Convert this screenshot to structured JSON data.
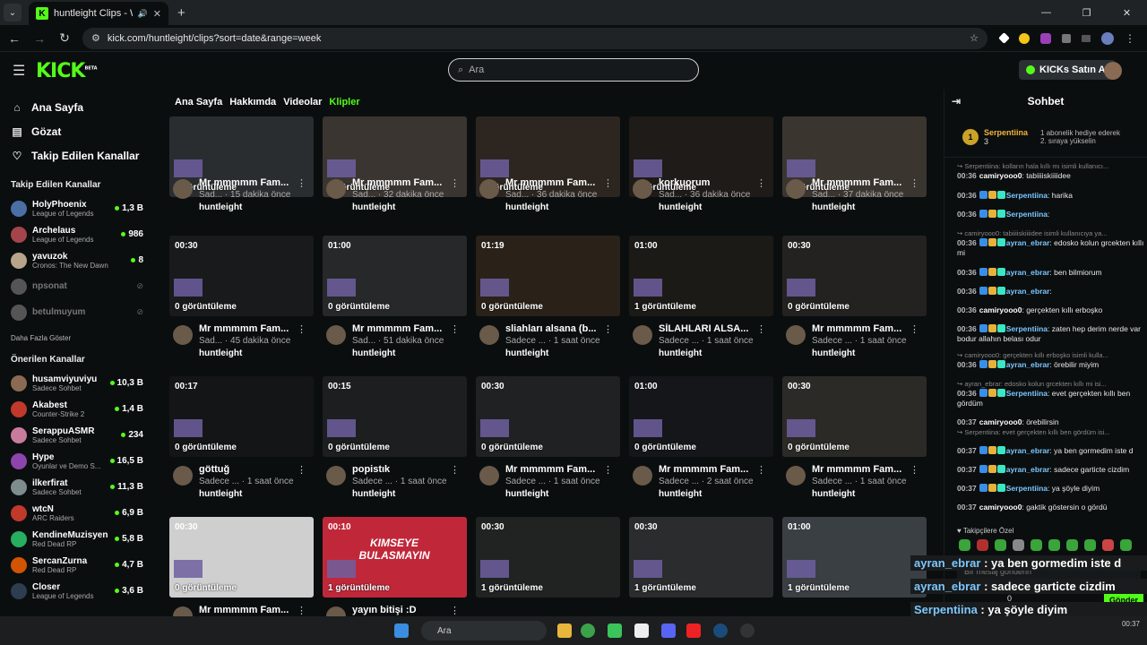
{
  "browser": {
    "tab_title": "huntleight Clips - Watch Li",
    "url": "kick.com/huntleight/clips?sort=date&range=week"
  },
  "header": {
    "logo": "KICK",
    "logo_sup": "BETA",
    "search_placeholder": "Ara",
    "buy_label": "KICKs Satın Al"
  },
  "sidebar": {
    "nav": [
      {
        "label": "Ana Sayfa",
        "icon": "home-icon"
      },
      {
        "label": "Gözat",
        "icon": "browse-icon"
      },
      {
        "label": "Takip Edilen Kanallar",
        "icon": "heart-icon"
      }
    ],
    "followed_title": "Takip Edilen Kanallar",
    "followed": [
      {
        "name": "HolyPhoenix",
        "game": "League of Legends",
        "viewers": "1,3 B",
        "color": "#4a6fa5"
      },
      {
        "name": "Archelaus",
        "game": "League of Legends",
        "viewers": "986",
        "color": "#a5444a"
      },
      {
        "name": "yavuzok",
        "game": "Cronos: The New Dawn",
        "viewers": "8",
        "color": "#b8a48a"
      },
      {
        "name": "npsonat",
        "game": "",
        "viewers": "",
        "color": "#555"
      },
      {
        "name": "betulmuyum",
        "game": "",
        "viewers": "",
        "color": "#555"
      }
    ],
    "show_more": "Daha Fazla Göster",
    "recommended_title": "Önerilen Kanallar",
    "recommended": [
      {
        "name": "husamviyuviyu",
        "game": "Sadece Sohbet",
        "viewers": "10,3 B",
        "color": "#8a6a52"
      },
      {
        "name": "Akabest",
        "game": "Counter-Strike 2",
        "viewers": "1,4 B",
        "color": "#c0392b"
      },
      {
        "name": "SerappuASMR",
        "game": "Sadece Sohbet",
        "viewers": "234",
        "color": "#c97b9e"
      },
      {
        "name": "Hype",
        "game": "Oyunlar ve Demo S...",
        "viewers": "16,5 B",
        "color": "#8e44ad"
      },
      {
        "name": "ilkerfirat",
        "game": "Sadece Sohbet",
        "viewers": "11,3 B",
        "color": "#7f8c8d"
      },
      {
        "name": "wtcN",
        "game": "ARC Raiders",
        "viewers": "6,9 B",
        "color": "#c0392b"
      },
      {
        "name": "KendineMuzisyen",
        "game": "Red Dead RP",
        "viewers": "5,8 B",
        "color": "#27ae60"
      },
      {
        "name": "SercanZurna",
        "game": "Red Dead RP",
        "viewers": "4,7 B",
        "color": "#d35400"
      },
      {
        "name": "Closer",
        "game": "League of Legends",
        "viewers": "3,6 B",
        "color": "#2c3e50"
      }
    ]
  },
  "content_tabs": [
    "Ana Sayfa",
    "Hakkımda",
    "Videolar",
    "Klipler"
  ],
  "clips": [
    {
      "duration": "",
      "views": "0 görüntüleme",
      "title": "Mr mmmmm Fam...",
      "sub": "Sad... · 15 dakika önce",
      "owner": "huntleight"
    },
    {
      "duration": "",
      "views": "0 görüntüleme",
      "title": "Mr mmmmm Fam...",
      "sub": "Sad... · 32 dakika önce",
      "owner": "huntleight"
    },
    {
      "duration": "",
      "views": "0 görüntüleme",
      "title": "Mr mmmmm Fam...",
      "sub": "Sad... · 36 dakika önce",
      "owner": "huntleight"
    },
    {
      "duration": "",
      "views": "0 görüntüleme",
      "title": "korkuorum",
      "sub": "Sad... · 36 dakika önce",
      "owner": "huntleight"
    },
    {
      "duration": "",
      "views": "0 görüntüleme",
      "title": "Mr mmmmm Fam...",
      "sub": "Sad... · 37 dakika önce",
      "owner": "huntleight"
    },
    {
      "duration": "00:30",
      "views": "0 görüntüleme",
      "title": "Mr mmmmm Fam...",
      "sub": "Sad... · 45 dakika önce",
      "owner": "huntleight"
    },
    {
      "duration": "01:00",
      "views": "0 görüntüleme",
      "title": "Mr mmmmm Fam...",
      "sub": "Sad... · 51 dakika önce",
      "owner": "huntleight"
    },
    {
      "duration": "01:19",
      "views": "0 görüntüleme",
      "title": "sliahları alsana (b...",
      "sub": "Sadece ... · 1 saat önce",
      "owner": "huntleight"
    },
    {
      "duration": "01:00",
      "views": "1 görüntüleme",
      "title": "SİLAHLARI ALSA...",
      "sub": "Sadece ... · 1 saat önce",
      "owner": "huntleight"
    },
    {
      "duration": "00:30",
      "views": "0 görüntüleme",
      "title": "Mr mmmmm Fam...",
      "sub": "Sadece ... · 1 saat önce",
      "owner": "huntleight"
    },
    {
      "duration": "00:17",
      "views": "0 görüntüleme",
      "title": "göttuğ",
      "sub": "Sadece ... · 1 saat önce",
      "owner": "huntleight"
    },
    {
      "duration": "00:15",
      "views": "0 görüntüleme",
      "title": "popistık",
      "sub": "Sadece ... · 1 saat önce",
      "owner": "huntleight"
    },
    {
      "duration": "00:30",
      "views": "0 görüntüleme",
      "title": "Mr mmmmm Fam...",
      "sub": "Sadece ... · 1 saat önce",
      "owner": "huntleight"
    },
    {
      "duration": "01:00",
      "views": "0 görüntüleme",
      "title": "Mr mmmmm Fam...",
      "sub": "Sadece ... · 2 saat önce",
      "owner": "huntleight"
    },
    {
      "duration": "00:30",
      "views": "0 görüntüleme",
      "title": "Mr mmmmm Fam...",
      "sub": "Sadece ... · 1 saat önce",
      "owner": "huntleight"
    },
    {
      "duration": "00:30",
      "views": "0 görüntüleme",
      "title": "Mr mmmmm Fam...",
      "sub": "",
      "owner": ""
    },
    {
      "duration": "00:10",
      "views": "1 görüntüleme",
      "title": "yayın bitişi :D",
      "sub": "",
      "owner": ""
    },
    {
      "duration": "00:30",
      "views": "1 görüntüleme",
      "title": "",
      "sub": "",
      "owner": ""
    },
    {
      "duration": "00:30",
      "views": "1 görüntüleme",
      "title": "",
      "sub": "",
      "owner": ""
    },
    {
      "duration": "01:00",
      "views": "1 görüntüleme",
      "title": "",
      "sub": "",
      "owner": ""
    }
  ],
  "clip_banner_text": "KIMSEYE BULASMAYIN",
  "chat": {
    "title": "Sohbet",
    "pinned_user": "Serpentiina",
    "pinned_count": "3",
    "pinned_rank": "1",
    "pinned_text": "1 abonelik hediye ederek 2. sıraya yükselin",
    "messages": [
      {
        "reply": "Serpentiina: kolların hala kıllı mı isimli kullanıcı...",
        "time": "",
        "user": "",
        "text": "",
        "color": ""
      },
      {
        "reply": "",
        "time": "00:36",
        "user": "camiryooo0",
        "text": ": tabiiiiskiiiidee",
        "color": "#ffffff"
      },
      {
        "reply": "",
        "time": "00:36",
        "user": "Serpentiina",
        "text": ": harika",
        "color": "#7cc7ff"
      },
      {
        "reply": "",
        "time": "00:36",
        "user": "Serpentiina",
        "text": ":",
        "color": "#7cc7ff"
      },
      {
        "reply": "camiryooo0: tabiiiiskiiiidee isimli kullanıcıya ya...",
        "time": "",
        "user": "",
        "text": "",
        "color": ""
      },
      {
        "reply": "",
        "time": "00:36",
        "user": "ayran_ebrar",
        "text": ": edosko kolun grcekten kıllı mi",
        "color": "#7cc7ff"
      },
      {
        "reply": "",
        "time": "00:36",
        "user": "ayran_ebrar",
        "text": ": ben bilmiorum",
        "color": "#7cc7ff"
      },
      {
        "reply": "",
        "time": "00:36",
        "user": "ayran_ebrar",
        "text": ":",
        "color": "#7cc7ff"
      },
      {
        "reply": "",
        "time": "00:36",
        "user": "camiryooo0",
        "text": ": gerçekten kıllı erboşko",
        "color": "#ffffff"
      },
      {
        "reply": "",
        "time": "00:36",
        "user": "Serpentiina",
        "text": ": zaten hep derim nerde var bodur allahın belası odur",
        "color": "#7cc7ff"
      },
      {
        "reply": "camiryooo0: gerçekten kıllı erboşko isimli kulla...",
        "time": "",
        "user": "",
        "text": "",
        "color": ""
      },
      {
        "reply": "",
        "time": "00:36",
        "user": "ayran_ebrar",
        "text": ": örebilir miyim",
        "color": "#7cc7ff"
      },
      {
        "reply": "ayran_ebrar: edosko kolun grcekten kıllı mi isi...",
        "time": "",
        "user": "",
        "text": "",
        "color": ""
      },
      {
        "reply": "",
        "time": "00:36",
        "user": "Serpentiina",
        "text": ": evet gerçekten kıllı ben gördüm",
        "color": "#7cc7ff"
      },
      {
        "reply": "",
        "time": "00:37",
        "user": "camiryooo0",
        "text": ": örebilirsin",
        "color": "#ffffff"
      },
      {
        "reply": "Serpentiina: evet gerçekten kıllı ben gördüm isi...",
        "time": "",
        "user": "",
        "text": "",
        "color": ""
      },
      {
        "reply": "",
        "time": "00:37",
        "user": "ayran_ebrar",
        "text": ": ya ben gormedim iste d",
        "color": "#7cc7ff"
      },
      {
        "reply": "",
        "time": "00:37",
        "user": "ayran_ebrar",
        "text": ": sadece garticte cizdim",
        "color": "#7cc7ff"
      },
      {
        "reply": "",
        "time": "00:37",
        "user": "Serpentiina",
        "text": ": ya şöyle diyim",
        "color": "#7cc7ff"
      },
      {
        "reply": "",
        "time": "00:37",
        "user": "camiryooo0",
        "text": ": gaktik göstersin o gördü",
        "color": "#ffffff"
      }
    ],
    "followers_only": "Takipçilere Özel",
    "input_placeholder": "Bir mesaj gönderin",
    "kicks_count": "0",
    "send_label": "Gönder"
  },
  "overlay_messages": [
    {
      "user": "ayran_ebrar",
      "text": " : ya ben gormedim iste d"
    },
    {
      "user": "ayran_ebrar",
      "text": " : sadece garticte cizdim"
    },
    {
      "user": "Serpentiina",
      "text": " : ya şöyle diyim"
    },
    {
      "user": "camiryooo0",
      "text": " : gaktik göstersin o gördü"
    }
  ],
  "taskbar": {
    "search": "Ara",
    "time": "00:37"
  }
}
